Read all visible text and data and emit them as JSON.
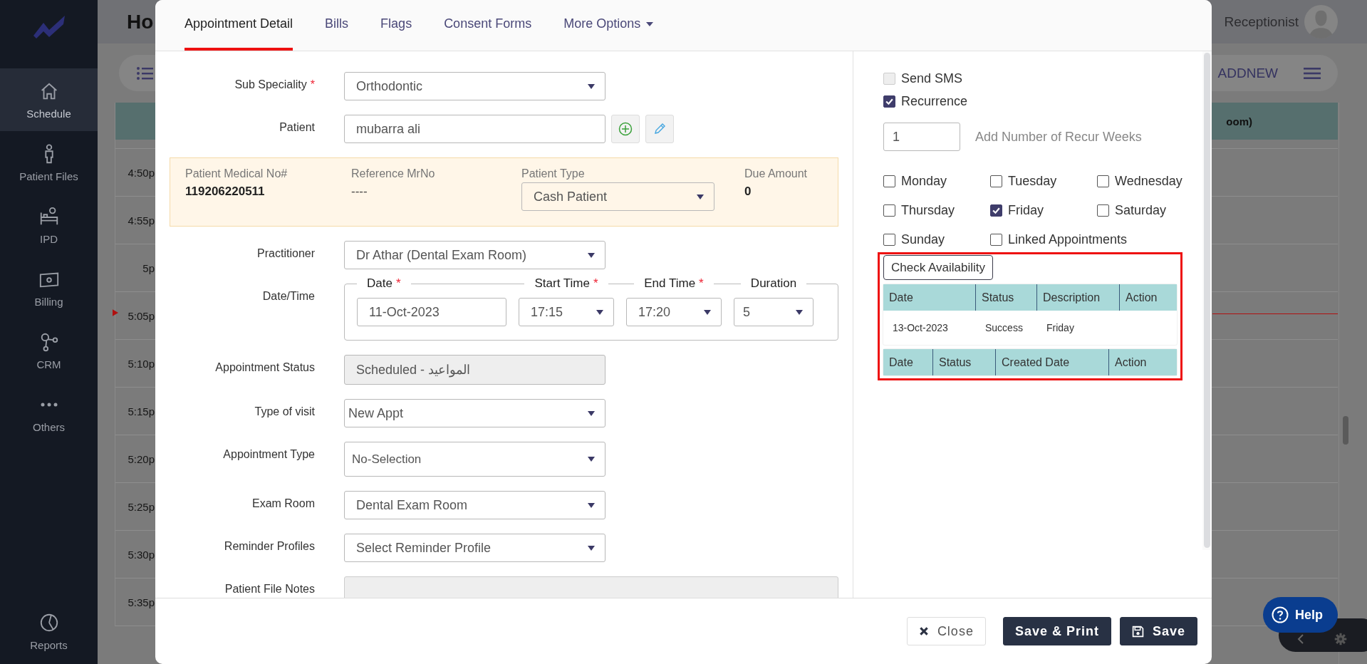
{
  "sidebar": {
    "items": [
      {
        "label": "Schedule",
        "selected": true
      },
      {
        "label": "Patient Files",
        "selected": false
      },
      {
        "label": "IPD",
        "selected": false
      },
      {
        "label": "Billing",
        "selected": false
      },
      {
        "label": "CRM",
        "selected": false
      },
      {
        "label": "Others",
        "selected": false
      }
    ],
    "bottom_item": {
      "label": "Reports"
    }
  },
  "background": {
    "title": "Ho",
    "user": "Receptionist",
    "add_new": "ADDNEW",
    "column_header": "oom)",
    "times": [
      "4:50p",
      "4:55p",
      "5p",
      "5:05p",
      "5:10p",
      "5:15p",
      "5:20p",
      "5:25p",
      "5:30p",
      "5:35p"
    ]
  },
  "modal": {
    "tabs": [
      {
        "label": "Appointment Detail",
        "kind": "tab",
        "selected": true
      },
      {
        "label": "Bills",
        "kind": "tab",
        "selected": false
      },
      {
        "label": "Flags",
        "kind": "tab",
        "selected": false
      },
      {
        "label": "Consent Forms",
        "kind": "tab",
        "selected": false
      },
      {
        "label": "More Options",
        "kind": "dropdown",
        "selected": false
      }
    ],
    "form": [
      {
        "kind": "select",
        "label": "Sub Speciality",
        "mark": "*",
        "value": "Orthodontic"
      },
      {
        "kind": "input_actions",
        "label": "Patient",
        "value": "mubarra ali"
      },
      {
        "kind": "info_panel",
        "fields": [
          {
            "kind": "text",
            "label": "Patient Medical No#",
            "value": "119206220511",
            "emphasis": true
          },
          {
            "kind": "text",
            "label": "Reference MrNo",
            "value": "----",
            "emphasis": false
          },
          {
            "kind": "select",
            "label": "Patient Type",
            "value": "Cash Patient"
          },
          {
            "kind": "text",
            "label": "Due Amount",
            "value": "0",
            "emphasis": true
          }
        ]
      },
      {
        "kind": "select",
        "label": "Practitioner",
        "value": "Dr Athar (Dental Exam Room)"
      },
      {
        "kind": "datetime",
        "label": "Date/Time",
        "fields": [
          {
            "kind": "input",
            "label": "Date",
            "mark": "*",
            "value": "11-Oct-2023"
          },
          {
            "kind": "select",
            "label": "Start Time",
            "mark": "*",
            "value": "17:15"
          },
          {
            "kind": "select",
            "label": "End Time",
            "mark": "*",
            "value": "17:20"
          },
          {
            "kind": "select",
            "label": "Duration",
            "value": "5"
          }
        ]
      },
      {
        "kind": "readonly",
        "label": "Appointment Status",
        "value": "Scheduled - المواعيد"
      },
      {
        "kind": "select",
        "label": "Type of visit",
        "value": "New Appt"
      },
      {
        "kind": "select",
        "label": "Appointment Type",
        "value": "No-Selection"
      },
      {
        "kind": "select",
        "label": "Exam Room",
        "value": "Dental Exam Room"
      },
      {
        "kind": "select",
        "label": "Reminder Profiles",
        "value": "Select Reminder Profile"
      },
      {
        "kind": "textarea",
        "label": "Patient File Notes"
      }
    ],
    "options": [
      {
        "label": "Send SMS",
        "checked": false,
        "disabled": true
      },
      {
        "label": "Recurrence",
        "checked": true,
        "disabled": false
      }
    ],
    "recur_weeks": {
      "value": "1",
      "label": "Add Number of Recur Weeks"
    },
    "days": [
      {
        "label": "Monday",
        "checked": false
      },
      {
        "label": "Tuesday",
        "checked": false
      },
      {
        "label": "Wednesday",
        "checked": false
      },
      {
        "label": "Thursday",
        "checked": false
      },
      {
        "label": "Friday",
        "checked": true
      },
      {
        "label": "Saturday",
        "checked": false
      },
      {
        "label": "Sunday",
        "checked": false
      },
      {
        "label": "Linked Appointments",
        "checked": false
      }
    ],
    "check_availability": "Check Availability",
    "availability_table": {
      "columns": [
        "Date",
        "Status",
        "Description",
        "Action"
      ],
      "rows": [
        [
          "13-Oct-2023",
          "Success",
          "Friday"
        ]
      ]
    },
    "linked_table": {
      "columns": [
        "Date",
        "Status",
        "Created Date",
        "Action"
      ]
    },
    "buttons": [
      {
        "kind": "close",
        "label": "Close"
      },
      {
        "kind": "primary",
        "label": "Save & Print"
      },
      {
        "kind": "save",
        "label": "Save"
      }
    ]
  },
  "help": "Help"
}
